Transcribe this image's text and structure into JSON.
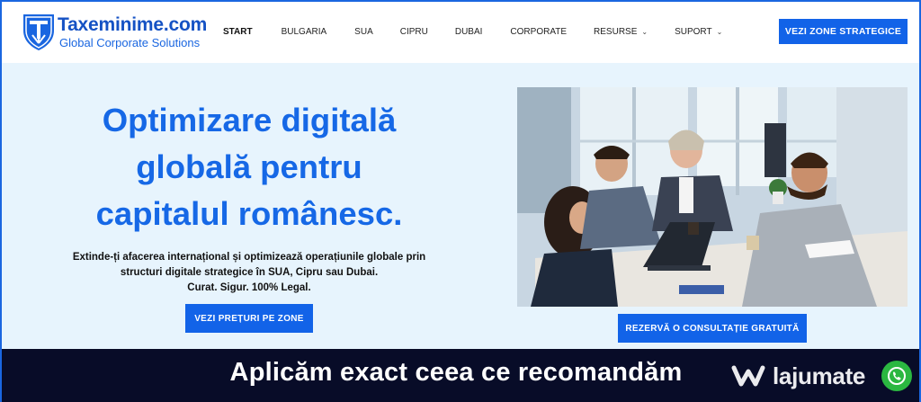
{
  "brand": {
    "name": "Taxeminime.com",
    "tagline": "Global Corporate Solutions",
    "accent": "#1263e8"
  },
  "nav": {
    "items": [
      {
        "label": "START",
        "active": true
      },
      {
        "label": "BULGARIA"
      },
      {
        "label": "SUA"
      },
      {
        "label": "CIPRU"
      },
      {
        "label": "DUBAI"
      },
      {
        "label": "CORPORATE"
      },
      {
        "label": "RESURSE",
        "dropdown": true
      },
      {
        "label": "SUPORT",
        "dropdown": true
      }
    ],
    "cta": "VEZI ZONE STRATEGICE"
  },
  "hero": {
    "title_line1": "Optimizare digitală",
    "title_line2": "globală pentru",
    "title_line3": "capitalul românesc.",
    "desc_line1": "Extinde-ți afacerea internațional și optimizează operațiunile globale prin",
    "desc_line2": "structuri digitale strategice în SUA, Cipru sau Dubai.",
    "desc_line3": "Curat. Sigur. 100% Legal.",
    "button": "VEZI PREȚURI PE ZONE",
    "consult_button": "REZERVĂ O CONSULTAȚIE GRATUITĂ"
  },
  "banner": {
    "text": "Aplicăm exact ceea ce recomandăm"
  },
  "watermark": {
    "text": "lajumate",
    "badge_icon": "whatsapp-icon"
  }
}
